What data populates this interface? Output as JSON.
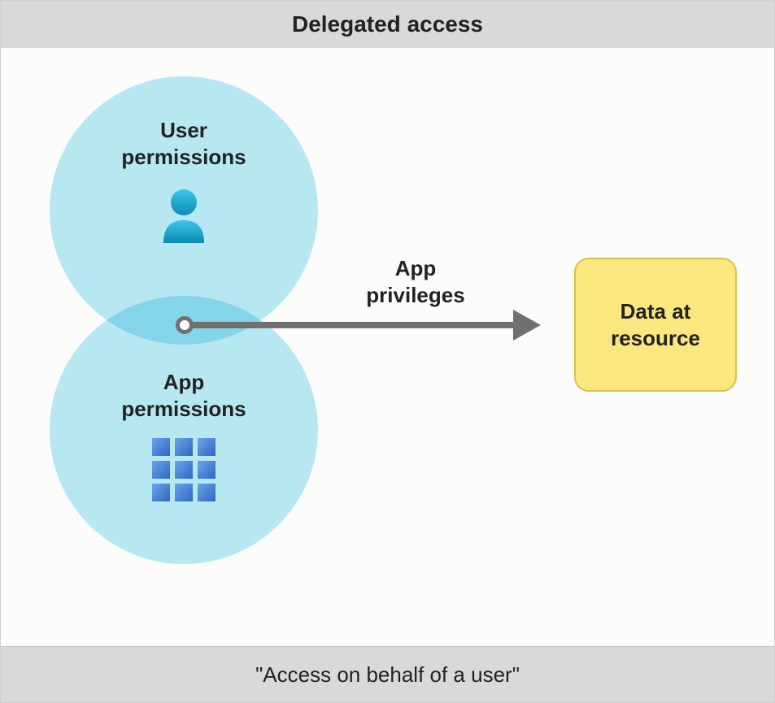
{
  "title": "Delegated access",
  "footer": "\"Access on behalf of a user\"",
  "venn": {
    "user_label": "User\npermissions",
    "app_label": "App\npermissions"
  },
  "arrow_label": "App\nprivileges",
  "resource_label": "Data at\nresource"
}
